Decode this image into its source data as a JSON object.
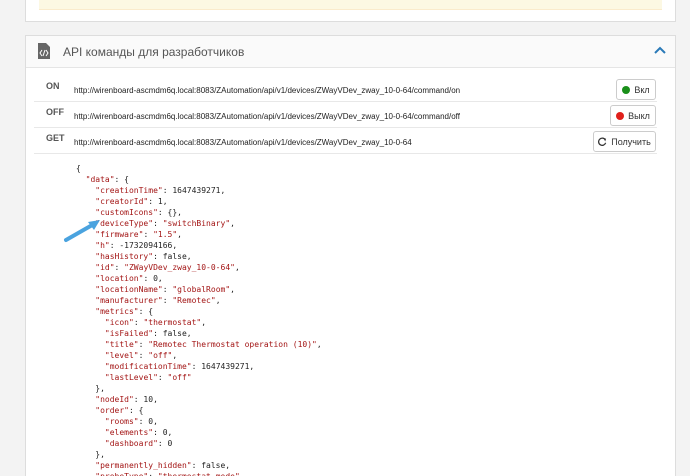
{
  "panel": {
    "title": "API команды для разработчиков"
  },
  "commands": [
    {
      "method": "ON",
      "url": "http://wirenboard-ascmdm6q.local:8083/ZAutomation/api/v1/devices/ZWayVDev_zway_10-0-64/command/on",
      "button": "Вкл",
      "dot_color": "#1a8f1a"
    },
    {
      "method": "OFF",
      "url": "http://wirenboard-ascmdm6q.local:8083/ZAutomation/api/v1/devices/ZWayVDev_zway_10-0-64/command/off",
      "button": "Выкл",
      "dot_color": "#e0201b"
    },
    {
      "method": "GET",
      "url": "http://wirenboard-ascmdm6q.local:8083/ZAutomation/api/v1/devices/ZWayVDev_zway_10-0-64",
      "button": "Получить",
      "icon": "refresh-icon"
    }
  ],
  "json_lines": [
    "{",
    "  \"data\": {",
    "    \"creationTime\": 1647439271,",
    "    \"creatorId\": 1,",
    "    \"customIcons\": {},",
    "    \"deviceType\": \"switchBinary\",",
    "    \"firmware\": \"1.5\",",
    "    \"h\": -1732094166,",
    "    \"hasHistory\": false,",
    "    \"id\": \"ZWayVDev_zway_10-0-64\",",
    "    \"location\": 0,",
    "    \"locationName\": \"globalRoom\",",
    "    \"manufacturer\": \"Remotec\",",
    "    \"metrics\": {",
    "      \"icon\": \"thermostat\",",
    "      \"isFailed\": false,",
    "      \"title\": \"Remotec Thermostat operation (10)\",",
    "      \"level\": \"off\",",
    "      \"modificationTime\": 1647439271,",
    "      \"lastLevel\": \"off\"",
    "    },",
    "    \"nodeId\": 10,",
    "    \"order\": {",
    "      \"rooms\": 0,",
    "      \"elements\": 0,",
    "      \"dashboard\": 0",
    "    },",
    "    \"permanently_hidden\": false,",
    "    \"probeType\": \"thermostat_mode\","
  ],
  "colors": {
    "arrow": "#4aa3df",
    "key": "#a31515"
  }
}
